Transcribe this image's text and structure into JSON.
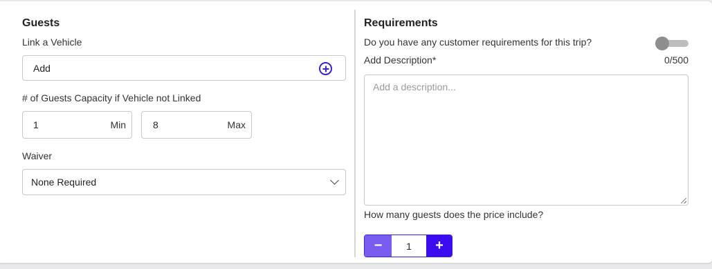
{
  "guests": {
    "heading": "Guests",
    "link_vehicle_label": "Link a Vehicle",
    "link_vehicle_value": "Add",
    "capacity_label": "# of Guests Capacity if Vehicle not Linked",
    "min_value": "1",
    "min_suffix": "Min",
    "max_value": "8",
    "max_suffix": "Max",
    "waiver_label": "Waiver",
    "waiver_value": "None Required"
  },
  "requirements": {
    "heading": "Requirements",
    "question": "Do you have any customer requirements for this trip?",
    "toggle_on": false,
    "description_label": "Add Description*",
    "char_count": "0/500",
    "description_placeholder": "Add a description...",
    "price_guests_label": "How many guests does the price include?",
    "price_guests_value": "1",
    "minus_symbol": "−",
    "plus_symbol": "+"
  },
  "colors": {
    "accent": "#3b21d6",
    "minus_bg": "#7a5cf0",
    "plus_bg": "#3b0cf0"
  }
}
